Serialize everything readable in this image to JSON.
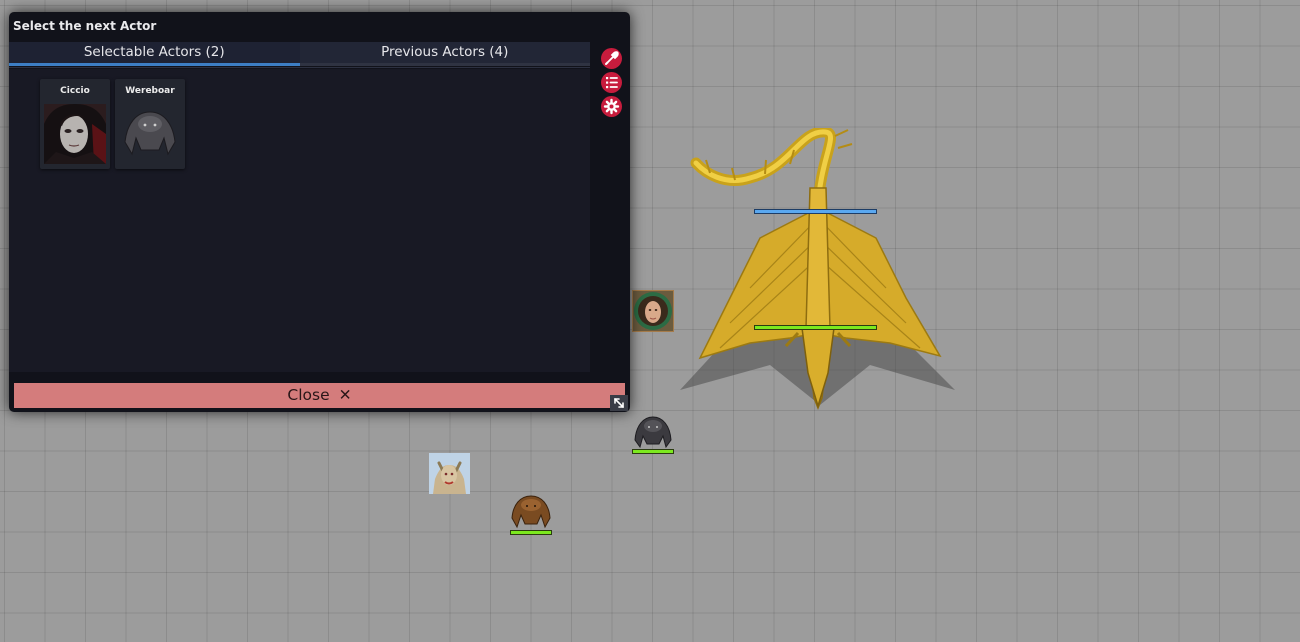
{
  "dialog": {
    "title": "Select the next Actor",
    "tabs": [
      {
        "label": "Selectable Actors (2)",
        "active": true
      },
      {
        "label": "Previous Actors (4)",
        "active": false
      }
    ],
    "actors": [
      {
        "name": "Ciccio",
        "portrait": "pale-vampire-portrait"
      },
      {
        "name": "Wereboar",
        "portrait": "wereboar-token"
      }
    ],
    "sidebar_icons": [
      "eyedropper-icon",
      "numbered-list-icon",
      "gear-icon"
    ],
    "close_label": "Close",
    "close_icon": "x-icon",
    "resize_icon": "resize-arrows-icon"
  },
  "map": {
    "grid": true,
    "tokens": [
      {
        "name": "gold-dragon-token",
        "hp_fraction": 1.0,
        "has_secondary_bar": true,
        "secondary_bar_color": "#5aa8f0"
      },
      {
        "name": "elf-woman-token",
        "hp_fraction": null
      },
      {
        "name": "wereboar-token",
        "hp_fraction": 1.0
      },
      {
        "name": "horned-warrior-token",
        "hp_fraction": null
      },
      {
        "name": "brown-beast-token",
        "hp_fraction": 1.0
      }
    ]
  },
  "colors": {
    "accent": "#3d7ec4",
    "hp_bar": "#7ce91f",
    "icon_red": "#c71c3d",
    "close_bar": "#d47c7c"
  }
}
